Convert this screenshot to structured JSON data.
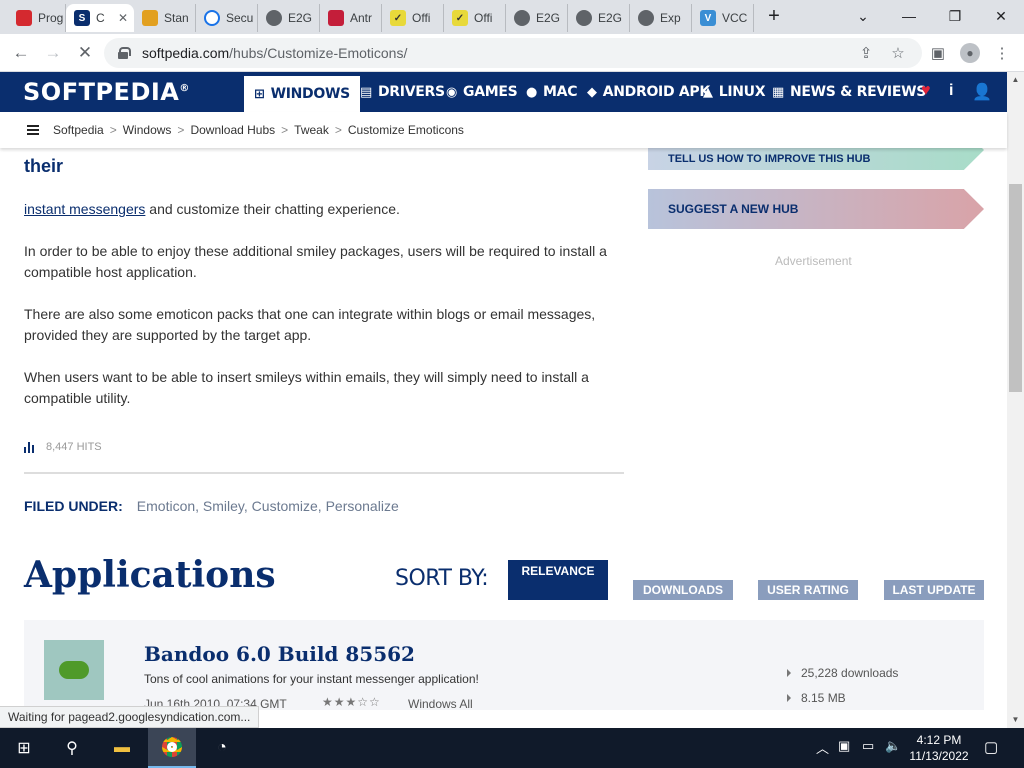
{
  "browser": {
    "tabs": [
      {
        "title": "Prog",
        "favicon": "red-app-icon",
        "color": "#d4292f"
      },
      {
        "title": "C",
        "favicon": "softpedia-icon",
        "color": "#0a2e6e",
        "active": true
      },
      {
        "title": "Stan",
        "favicon": "colorful-icon",
        "color": "#e2a020"
      },
      {
        "title": "Secu",
        "favicon": "loading-icon",
        "color": "#1a73e8"
      },
      {
        "title": "E2G",
        "favicon": "globe-icon",
        "color": "#5f6368"
      },
      {
        "title": "Antr",
        "favicon": "shield-icon",
        "color": "#c41e3a"
      },
      {
        "title": "Offi",
        "favicon": "check-icon",
        "color": "#e8d93a"
      },
      {
        "title": "Offi",
        "favicon": "check-icon",
        "color": "#e8d93a"
      },
      {
        "title": "E2G",
        "favicon": "globe-icon",
        "color": "#5f6368"
      },
      {
        "title": "E2G",
        "favicon": "globe-icon",
        "color": "#5f6368"
      },
      {
        "title": "Exp",
        "favicon": "globe-icon",
        "color": "#5f6368"
      },
      {
        "title": "VCC",
        "favicon": "v-icon",
        "color": "#3a8ed4"
      }
    ],
    "url_host": "softpedia.com",
    "url_path": "/hubs/Customize-Emoticons/",
    "status_text": "Waiting for pagead2.googlesyndication.com..."
  },
  "site": {
    "logo": "SOFTPEDIA",
    "logo_mark": "®",
    "nav": [
      {
        "label": "WINDOWS",
        "icon": "windows-icon",
        "active": true
      },
      {
        "label": "DRIVERS",
        "icon": "drivers-icon"
      },
      {
        "label": "GAMES",
        "icon": "gamepad-icon"
      },
      {
        "label": "MAC",
        "icon": "apple-icon"
      },
      {
        "label": "ANDROID APK",
        "icon": "android-icon"
      },
      {
        "label": "LINUX",
        "icon": "linux-icon"
      },
      {
        "label": "NEWS & REVIEWS",
        "icon": "news-icon"
      }
    ],
    "breadcrumb": [
      "Softpedia",
      "Windows",
      "Download Hubs",
      "Tweak",
      "Customize Emoticons"
    ]
  },
  "article": {
    "heading_fragment": "their",
    "link_text": "instant messengers",
    "p1_rest": " and customize their chatting experience.",
    "p2": "In order to be able to enjoy these additional smiley packages, users will be required to install a compatible host application.",
    "p3": "There are also some emoticon packs that one can integrate within blogs or email messages, provided they are supported by the target app.",
    "p4": "When users want to be able to insert smileys within emails, they will simply need to install a compatible utility.",
    "hits": "8,447 HITS",
    "filed_label": "FILED UNDER:",
    "filed_tags": "Emoticon, Smiley, Customize, Personalize"
  },
  "sidebar": {
    "tell_us": "TELL US HOW TO IMPROVE THIS HUB",
    "suggest": "SUGGEST A NEW HUB",
    "ad_label": "Advertisement"
  },
  "apps": {
    "title": "Applications",
    "sort_by": "SORT BY:",
    "sort_options": [
      "RELEVANCE",
      "DOWNLOADS",
      "USER RATING",
      "LAST UPDATE"
    ],
    "items": [
      {
        "name": "Bandoo 6.0 Build 85562",
        "desc": "Tons of cool animations for your instant messenger application!",
        "date": "Jun 16th 2010, 07:34 GMT",
        "stars": "★★★☆☆",
        "rating": 3,
        "os": "Windows All",
        "downloads": "25,228 downloads",
        "size": "8.15 MB"
      }
    ]
  },
  "taskbar": {
    "time": "4:12 PM",
    "date": "11/13/2022"
  },
  "colors": {
    "brand_navy": "#0a2e6e",
    "sort_inactive": "#8a9dbd"
  }
}
